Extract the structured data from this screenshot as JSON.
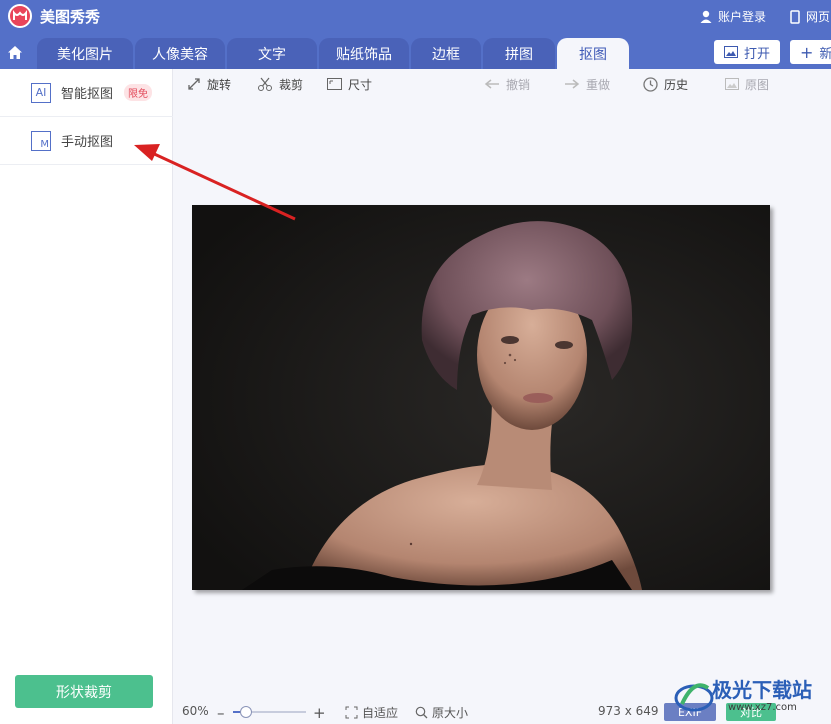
{
  "app": {
    "name": "美图秀秀"
  },
  "titlebar": {
    "account_label": "账户登录",
    "web_label": "网页"
  },
  "tabs": [
    {
      "label": "美化图片"
    },
    {
      "label": "人像美容"
    },
    {
      "label": "文字"
    },
    {
      "label": "贴纸饰品"
    },
    {
      "label": "边框"
    },
    {
      "label": "拼图"
    },
    {
      "label": "抠图"
    }
  ],
  "active_tab": "抠图",
  "header_buttons": {
    "open_label": "打开",
    "new_label": "新"
  },
  "left_panel": {
    "items": [
      {
        "icon_text": "AI",
        "label": "智能抠图",
        "badge": "限免"
      },
      {
        "icon_text": "M",
        "label": "手动抠图"
      }
    ],
    "shape_crop_label": "形状裁剪"
  },
  "toolbar": {
    "rotate": "旋转",
    "crop": "裁剪",
    "size": "尺寸",
    "undo": "撤销",
    "redo": "重做",
    "history": "历史",
    "original": "原图"
  },
  "status": {
    "zoom": "60%",
    "zoom_fraction": 0.15,
    "fit_label": "自适应",
    "actual_size_label": "原大小",
    "dimensions": "973 x 649",
    "exif_label": "EXIF",
    "compare_label": "对比"
  },
  "watermark": {
    "text": "极光下载站",
    "url": "www.xz7.com"
  },
  "colors": {
    "accent": "#5470c8",
    "green": "#4cc08e",
    "arrow": "#d92222"
  }
}
